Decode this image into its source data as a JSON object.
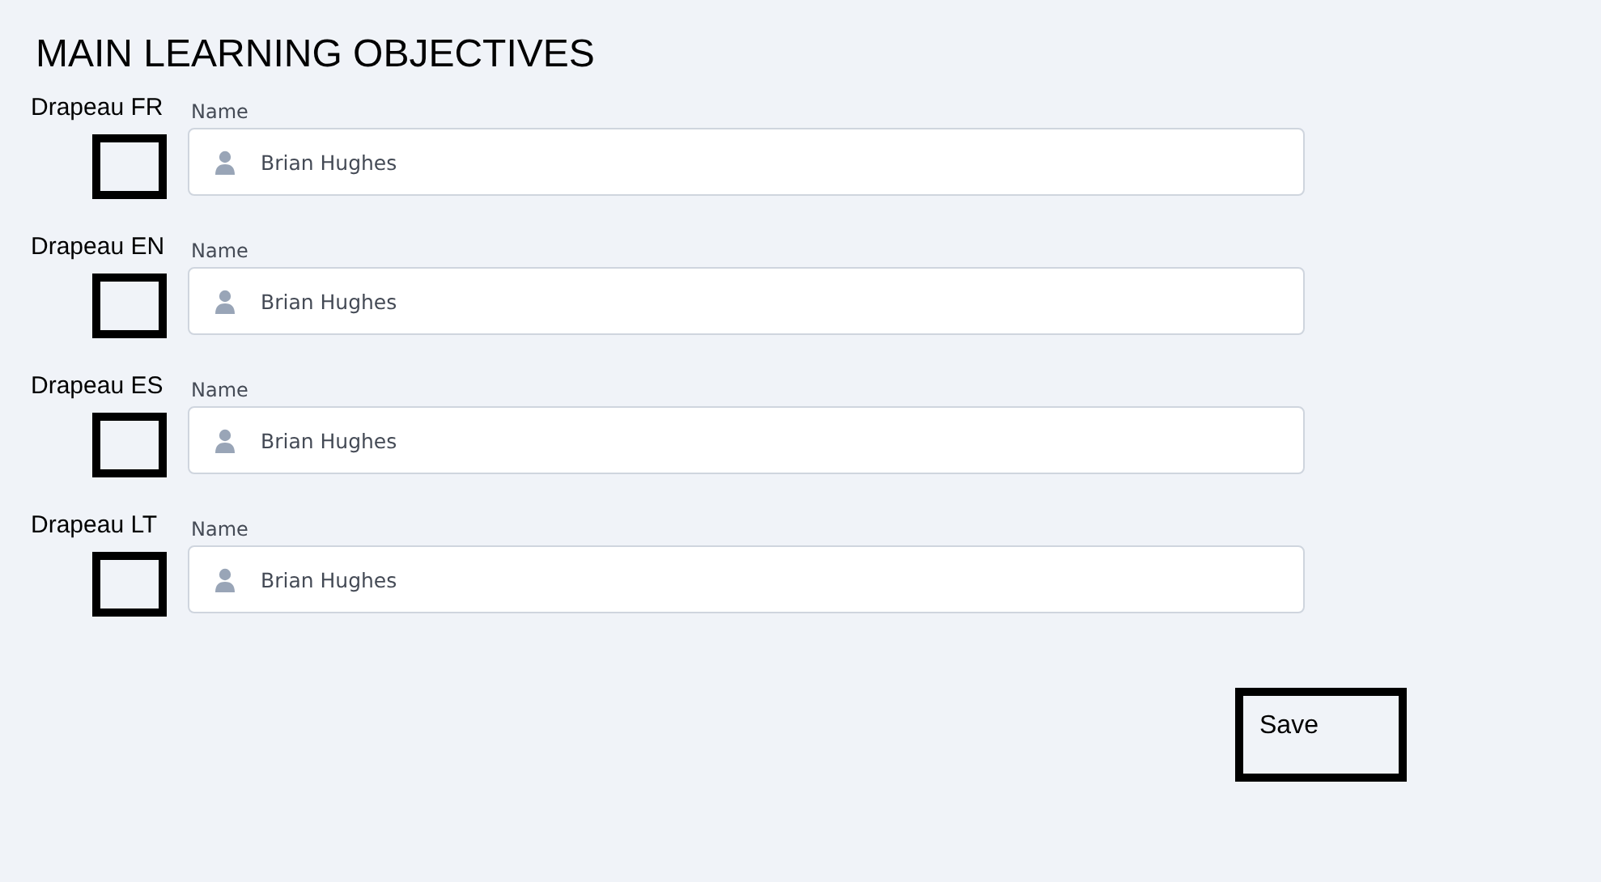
{
  "title": "MAIN LEARNING OBJECTIVES",
  "rows": [
    {
      "label": "Drapeau FR",
      "field_label": "Name",
      "value": "Brian Hughes"
    },
    {
      "label": "Drapeau EN",
      "field_label": "Name",
      "value": "Brian Hughes"
    },
    {
      "label": "Drapeau ES",
      "field_label": "Name",
      "value": "Brian Hughes"
    },
    {
      "label": "Drapeau LT",
      "field_label": "Name",
      "value": "Brian Hughes"
    }
  ],
  "save_button": "Save"
}
